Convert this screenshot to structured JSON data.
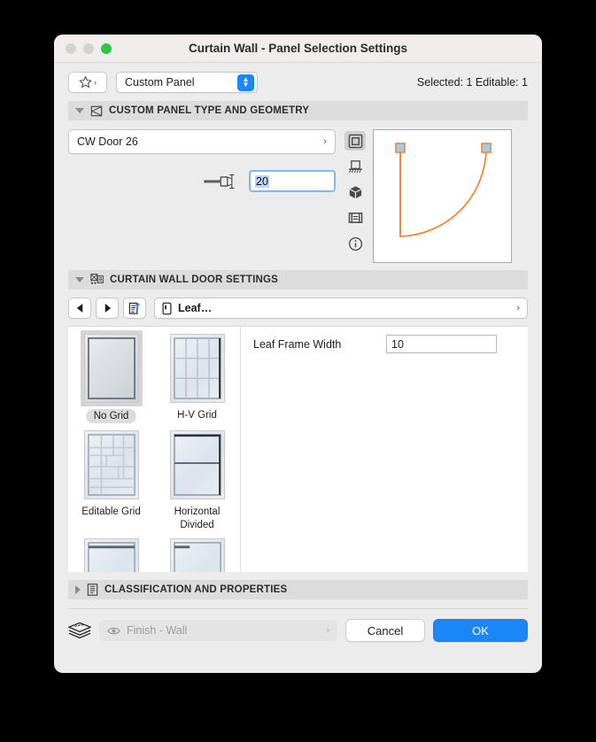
{
  "window": {
    "title": "Curtain Wall - Panel Selection Settings",
    "traffic_lights": [
      "close-button",
      "minimize-button",
      "maximize-button"
    ],
    "accent_color": "#1b87f7",
    "titlebar_color": "#f3eced"
  },
  "toolbar": {
    "favorites_icon": "star-icon",
    "favorites_chevron": "›",
    "panel_type": "Custom Panel",
    "selection_info": "Selected: 1 Editable: 1"
  },
  "geometry_section": {
    "expanded": true,
    "icon": "panel-geometry-icon",
    "title": "CUSTOM PANEL TYPE AND GEOMETRY",
    "panel_name": "CW Door 26",
    "panel_chevron": "›",
    "thickness_icon": "panel-thickness-icon",
    "thickness_value": "20",
    "view_icons": [
      {
        "name": "2d-plan-view-icon",
        "active": true
      },
      {
        "name": "elevation-view-icon",
        "active": false
      },
      {
        "name": "3d-view-icon",
        "active": false
      },
      {
        "name": "section-view-icon",
        "active": false
      },
      {
        "name": "info-icon",
        "active": false
      }
    ],
    "preview": {
      "name": "door-swing-preview",
      "line_color": "#f58634",
      "handle_color": "#9ecbf0"
    }
  },
  "door_section": {
    "expanded": true,
    "icon": "curtain-wall-door-icon",
    "title": "CURTAIN WALL DOOR SETTINGS",
    "nav": {
      "back_icon": "back-arrow-icon",
      "forward_icon": "forward-arrow-icon",
      "list_icon": "list-export-icon",
      "item_icon": "leaf-item-icon",
      "item_label": "Leaf…",
      "chevron": "›"
    },
    "thumbnails": [
      {
        "label": "No Grid",
        "selected": true,
        "pattern": "plain"
      },
      {
        "label": "H-V Grid",
        "selected": false,
        "pattern": "hv"
      },
      {
        "label": "Editable Grid",
        "selected": false,
        "pattern": "editable"
      },
      {
        "label": "Horizontal Divided",
        "selected": false,
        "pattern": "horizontal"
      },
      {
        "label": "",
        "selected": false,
        "pattern": "partial-a"
      },
      {
        "label": "",
        "selected": false,
        "pattern": "partial-b"
      }
    ],
    "fields": [
      {
        "label": "Leaf Frame Width",
        "value": "10"
      }
    ]
  },
  "classification_section": {
    "expanded": false,
    "icon": "classification-icon",
    "title": "CLASSIFICATION AND PROPERTIES"
  },
  "footer": {
    "layers_icon": "layers-stack-icon",
    "eye_icon": "eye-icon",
    "layer_name": "Finish - Wall",
    "layer_chevron": "›",
    "cancel_label": "Cancel",
    "ok_label": "OK"
  }
}
